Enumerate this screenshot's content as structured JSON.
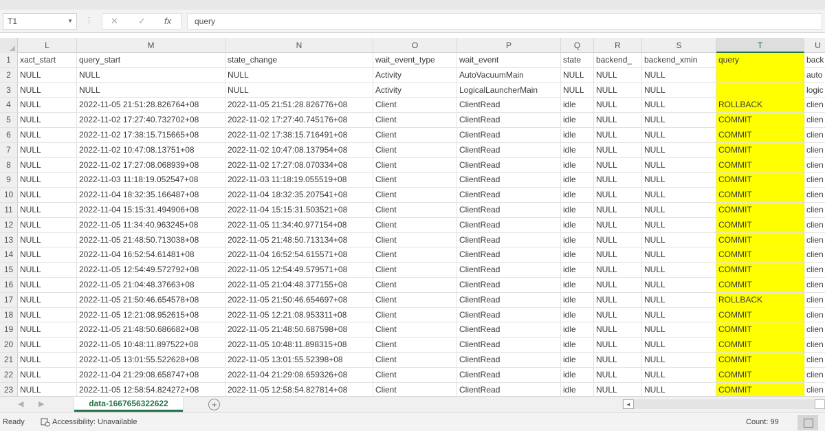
{
  "formula_bar": {
    "name_box": "T1",
    "cancel_icon": "✕",
    "enter_icon": "✓",
    "fx_label": "fx",
    "content": "query"
  },
  "columns": [
    {
      "letter": "L",
      "header": "xact_start"
    },
    {
      "letter": "M",
      "header": "query_start"
    },
    {
      "letter": "N",
      "header": "state_change"
    },
    {
      "letter": "O",
      "header": "wait_event_type"
    },
    {
      "letter": "P",
      "header": "wait_event"
    },
    {
      "letter": "Q",
      "header": "state"
    },
    {
      "letter": "R",
      "header": "backend_"
    },
    {
      "letter": "S",
      "header": "backend_xmin"
    },
    {
      "letter": "T",
      "header": "query"
    },
    {
      "letter": "U",
      "header": "back"
    }
  ],
  "selected_column": "T",
  "highlight_color": "#ffff00",
  "rows": [
    [
      "1",
      "xact_start",
      "query_start",
      "state_change",
      "wait_event_type",
      "wait_event",
      "state",
      "backend_",
      "backend_xmin",
      "query",
      "back"
    ],
    [
      "2",
      "NULL",
      "NULL",
      "NULL",
      "Activity",
      "AutoVacuumMain",
      "NULL",
      "NULL",
      "NULL",
      "",
      "auto"
    ],
    [
      "3",
      "NULL",
      "NULL",
      "NULL",
      "Activity",
      "LogicalLauncherMain",
      "NULL",
      "NULL",
      "NULL",
      "",
      "logic"
    ],
    [
      "4",
      "NULL",
      "2022-11-05 21:51:28.826764+08",
      "2022-11-05 21:51:28.826776+08",
      "Client",
      "ClientRead",
      "idle",
      "NULL",
      "NULL",
      "ROLLBACK",
      "clien"
    ],
    [
      "5",
      "NULL",
      "2022-11-02 17:27:40.732702+08",
      "2022-11-02 17:27:40.745176+08",
      "Client",
      "ClientRead",
      "idle",
      "NULL",
      "NULL",
      "COMMIT",
      "clien"
    ],
    [
      "6",
      "NULL",
      "2022-11-02 17:38:15.715665+08",
      "2022-11-02 17:38:15.716491+08",
      "Client",
      "ClientRead",
      "idle",
      "NULL",
      "NULL",
      "COMMIT",
      "clien"
    ],
    [
      "7",
      "NULL",
      "2022-11-02 10:47:08.13751+08",
      "2022-11-02 10:47:08.137954+08",
      "Client",
      "ClientRead",
      "idle",
      "NULL",
      "NULL",
      "COMMIT",
      "clien"
    ],
    [
      "8",
      "NULL",
      "2022-11-02 17:27:08.068939+08",
      "2022-11-02 17:27:08.070334+08",
      "Client",
      "ClientRead",
      "idle",
      "NULL",
      "NULL",
      "COMMIT",
      "clien"
    ],
    [
      "9",
      "NULL",
      "2022-11-03 11:18:19.052547+08",
      "2022-11-03 11:18:19.055519+08",
      "Client",
      "ClientRead",
      "idle",
      "NULL",
      "NULL",
      "COMMIT",
      "clien"
    ],
    [
      "10",
      "NULL",
      "2022-11-04 18:32:35.166487+08",
      "2022-11-04 18:32:35.207541+08",
      "Client",
      "ClientRead",
      "idle",
      "NULL",
      "NULL",
      "COMMIT",
      "clien"
    ],
    [
      "11",
      "NULL",
      "2022-11-04 15:15:31.494906+08",
      "2022-11-04 15:15:31.503521+08",
      "Client",
      "ClientRead",
      "idle",
      "NULL",
      "NULL",
      "COMMIT",
      "clien"
    ],
    [
      "12",
      "NULL",
      "2022-11-05 11:34:40.963245+08",
      "2022-11-05 11:34:40.977154+08",
      "Client",
      "ClientRead",
      "idle",
      "NULL",
      "NULL",
      "COMMIT",
      "clien"
    ],
    [
      "13",
      "NULL",
      "2022-11-05 21:48:50.713038+08",
      "2022-11-05 21:48:50.713134+08",
      "Client",
      "ClientRead",
      "idle",
      "NULL",
      "NULL",
      "COMMIT",
      "clien"
    ],
    [
      "14",
      "NULL",
      "2022-11-04 16:52:54.61481+08",
      "2022-11-04 16:52:54.615571+08",
      "Client",
      "ClientRead",
      "idle",
      "NULL",
      "NULL",
      "COMMIT",
      "clien"
    ],
    [
      "15",
      "NULL",
      "2022-11-05 12:54:49.572792+08",
      "2022-11-05 12:54:49.579571+08",
      "Client",
      "ClientRead",
      "idle",
      "NULL",
      "NULL",
      "COMMIT",
      "clien"
    ],
    [
      "16",
      "NULL",
      "2022-11-05 21:04:48.37663+08",
      "2022-11-05 21:04:48.377155+08",
      "Client",
      "ClientRead",
      "idle",
      "NULL",
      "NULL",
      "COMMIT",
      "clien"
    ],
    [
      "17",
      "NULL",
      "2022-11-05 21:50:46.654578+08",
      "2022-11-05 21:50:46.654697+08",
      "Client",
      "ClientRead",
      "idle",
      "NULL",
      "NULL",
      "ROLLBACK",
      "clien"
    ],
    [
      "18",
      "NULL",
      "2022-11-05 12:21:08.952615+08",
      "2022-11-05 12:21:08.953311+08",
      "Client",
      "ClientRead",
      "idle",
      "NULL",
      "NULL",
      "COMMIT",
      "clien"
    ],
    [
      "19",
      "NULL",
      "2022-11-05 21:48:50.686682+08",
      "2022-11-05 21:48:50.687598+08",
      "Client",
      "ClientRead",
      "idle",
      "NULL",
      "NULL",
      "COMMIT",
      "clien"
    ],
    [
      "20",
      "NULL",
      "2022-11-05 10:48:11.897522+08",
      "2022-11-05 10:48:11.898315+08",
      "Client",
      "ClientRead",
      "idle",
      "NULL",
      "NULL",
      "COMMIT",
      "clien"
    ],
    [
      "21",
      "NULL",
      "2022-11-05 13:01:55.522628+08",
      "2022-11-05 13:01:55.52398+08",
      "Client",
      "ClientRead",
      "idle",
      "NULL",
      "NULL",
      "COMMIT",
      "clien"
    ],
    [
      "22",
      "NULL",
      "2022-11-04 21:29:08.658747+08",
      "2022-11-04 21:29:08.659326+08",
      "Client",
      "ClientRead",
      "idle",
      "NULL",
      "NULL",
      "COMMIT",
      "clien"
    ],
    [
      "23",
      "NULL",
      "2022-11-05 12:58:54.824272+08",
      "2022-11-05 12:58:54.827814+08",
      "Client",
      "ClientRead",
      "idle",
      "NULL",
      "NULL",
      "COMMIT",
      "clien"
    ]
  ],
  "sheet_tabs": {
    "active": "data-1667656322622",
    "add_sheet_icon": "+"
  },
  "statusbar": {
    "ready": "Ready",
    "accessibility": "Accessibility: Unavailable",
    "count": "Count: 99"
  }
}
